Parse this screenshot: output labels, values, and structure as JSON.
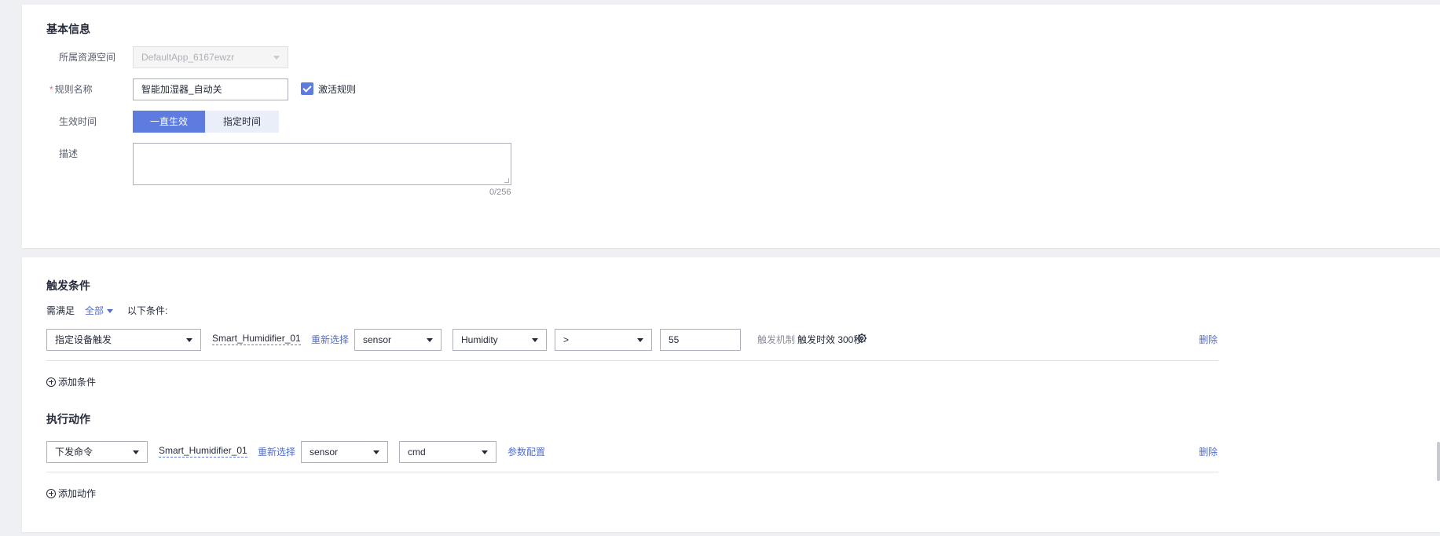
{
  "basic_info": {
    "title": "基本信息",
    "resource_space": {
      "label": "所属资源空间",
      "value": "DefaultApp_6167ewzr"
    },
    "rule_name": {
      "label": "规则名称",
      "value": "智能加湿器_自动关"
    },
    "activate": {
      "label": "激活规则",
      "checked": true
    },
    "effective_time": {
      "label": "生效时间",
      "options": [
        "一直生效",
        "指定时间"
      ],
      "selected": "一直生效"
    },
    "description": {
      "label": "描述",
      "value": "",
      "counter": "0/256"
    }
  },
  "trigger": {
    "title": "触发条件",
    "prefix": "需满足",
    "match_mode": "全部",
    "suffix": "以下条件:",
    "condition": {
      "type": "指定设备触发",
      "device": "Smart_Humidifier_01",
      "reselect": "重新选择",
      "service": "sensor",
      "property": "Humidity",
      "operator": ">",
      "value": "55",
      "mechanism_label": "触发机制",
      "mechanism_value": "触发时效 300秒",
      "delete": "删除"
    },
    "add_label": "添加条件"
  },
  "action": {
    "title": "执行动作",
    "row": {
      "type": "下发命令",
      "device": "Smart_Humidifier_01",
      "reselect": "重新选择",
      "service": "sensor",
      "command": "cmd",
      "params": "参数配置",
      "delete": "删除"
    },
    "add_label": "添加动作"
  },
  "colors": {
    "accent": "#5e7ce0",
    "link": "#526ecc",
    "required": "#f66f6a",
    "background": "#eff0f3"
  }
}
